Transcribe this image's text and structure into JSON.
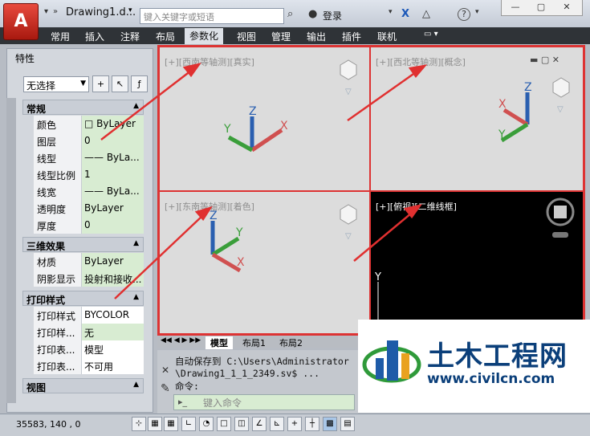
{
  "titlebar": {
    "app_logo": "A",
    "title": "Drawing1.d...",
    "search_placeholder": "键入关键字或短语",
    "login": "登录"
  },
  "window_controls": {
    "minimize": "—",
    "restore": "▢",
    "close": "✕"
  },
  "ribbon": {
    "tabs": [
      "常用",
      "插入",
      "注释",
      "布局",
      "参数化",
      "视图",
      "管理",
      "输出",
      "插件",
      "联机"
    ],
    "active": "参数化"
  },
  "properties": {
    "title": "特性",
    "selection": "无选择",
    "sections": [
      {
        "name": "常规",
        "rows": [
          {
            "k": "颜色",
            "v": "□ ByLayer"
          },
          {
            "k": "图层",
            "v": "0"
          },
          {
            "k": "线型",
            "v": "—— ByLa..."
          },
          {
            "k": "线型比例",
            "v": "1"
          },
          {
            "k": "线宽",
            "v": "—— ByLa..."
          },
          {
            "k": "透明度",
            "v": "ByLayer"
          },
          {
            "k": "厚度",
            "v": "0"
          }
        ]
      },
      {
        "name": "三维效果",
        "rows": [
          {
            "k": "材质",
            "v": "ByLayer"
          },
          {
            "k": "阴影显示",
            "v": "投射和接收..."
          }
        ]
      },
      {
        "name": "打印样式",
        "rows": [
          {
            "k": "打印样式",
            "v": "BYCOLOR"
          },
          {
            "k": "打印样...",
            "v": "无"
          },
          {
            "k": "打印表...",
            "v": "模型"
          },
          {
            "k": "打印表...",
            "v": "不可用"
          }
        ]
      },
      {
        "name": "视图",
        "rows": []
      }
    ]
  },
  "viewports": [
    {
      "label": "[+][西南等轴测][真实]"
    },
    {
      "label": "[+][西北等轴测][概念]"
    },
    {
      "label": "[+][东南等轴测][着色]"
    },
    {
      "label": "[+][俯视][二维线框]"
    }
  ],
  "layout_tabs": [
    "模型",
    "布局1",
    "布局2"
  ],
  "command": {
    "lines": [
      "自动保存到 C:\\Users\\Administrator",
      "\\Drawing1_1_1_2349.sv$ ...",
      "命令:"
    ],
    "input_placeholder": "键入命令"
  },
  "status": {
    "coords": "35583, 140 , 0"
  },
  "watermark": {
    "cn": "土木工程网",
    "url": "www.civilcn.com"
  }
}
